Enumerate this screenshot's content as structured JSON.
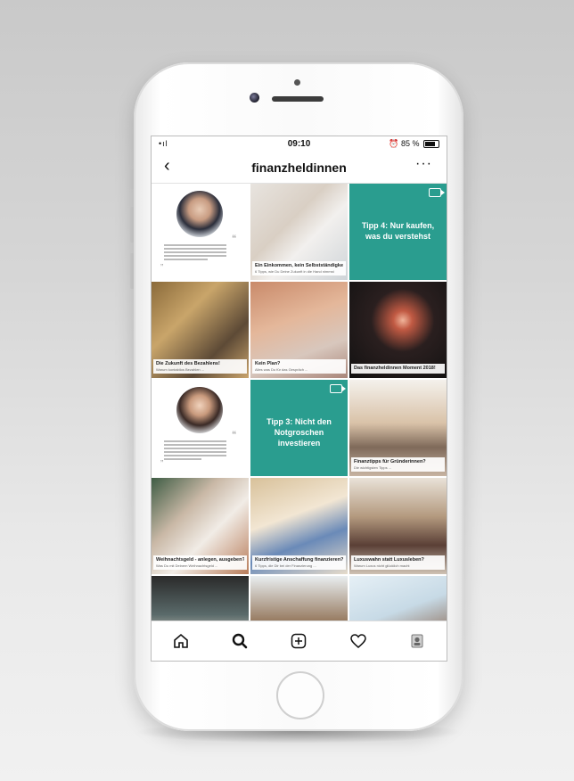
{
  "status_bar": {
    "time": "09:10",
    "battery": "85 %",
    "signal": "•ıl"
  },
  "header": {
    "back": "‹",
    "title": "finanzheldinnen",
    "more": "···"
  },
  "tiles": [
    {
      "kind": "quote"
    },
    {
      "kind": "photo",
      "caption": "Ein Einkommen, kein Selbstständigkeit?",
      "sub": "6 Tipps, wie Du Deine Zukunft in die Hand nimmst"
    },
    {
      "kind": "teal",
      "text": "Tipp 4: Nur kaufen, was du verstehst"
    },
    {
      "kind": "photo",
      "caption": "Die Zukunft des Bezahlens!",
      "sub": "Warum kontaktlos Bezahlen ..."
    },
    {
      "kind": "photo",
      "caption": "Kein Plan?",
      "sub": "Alles was Du für das Gespräch ..."
    },
    {
      "kind": "photo",
      "caption": "Das finanzheldinnen Moment 2018!",
      "sub": ""
    },
    {
      "kind": "quote"
    },
    {
      "kind": "teal",
      "text": "Tipp 3: Nicht den Notgroschen investieren"
    },
    {
      "kind": "photo",
      "caption": "Finanztipps für Gründerinnen?",
      "sub": "Die wichtigsten Tipps ..."
    },
    {
      "kind": "photo",
      "caption": "Weihnachtsgeld - anlegen, ausgeben?",
      "sub": "Was Du mit Deinem Weihnachtsgeld ..."
    },
    {
      "kind": "photo",
      "caption": "Kurzfristige Anschaffung finanzieren?",
      "sub": "6 Tipps, die Dir bei der Finanzierung ..."
    },
    {
      "kind": "photo",
      "caption": "Luxuswahn statt Luxusleben?",
      "sub": "Warum Luxus nicht glücklich macht"
    },
    {
      "kind": "photo",
      "caption": "",
      "sub": ""
    },
    {
      "kind": "photo",
      "caption": "",
      "sub": ""
    },
    {
      "kind": "photo",
      "caption": "",
      "sub": ""
    }
  ],
  "tabbar": [
    "home-icon",
    "search-icon",
    "add-icon",
    "heart-icon",
    "profile-icon"
  ],
  "colors": {
    "teal": "#2a9d8f"
  }
}
